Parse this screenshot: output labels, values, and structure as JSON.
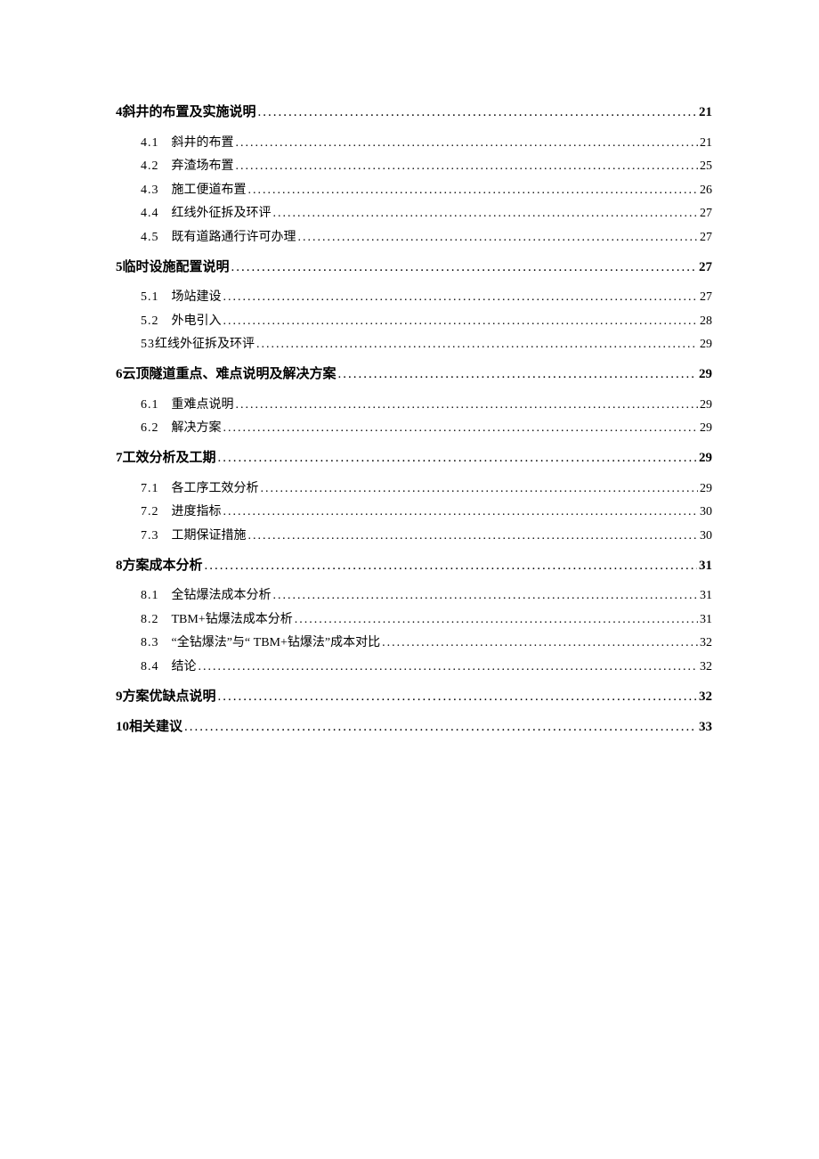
{
  "toc": [
    {
      "level": 1,
      "num": "4",
      "title": "斜井的布置及实施说明",
      "page": "21"
    },
    {
      "level": 2,
      "num": "4.1",
      "title": "斜井的布置",
      "page": "21"
    },
    {
      "level": 2,
      "num": "4.2",
      "title": "弃渣场布置",
      "page": "25"
    },
    {
      "level": 2,
      "num": "4.3",
      "title": "施工便道布置",
      "page": "26"
    },
    {
      "level": 2,
      "num": "4.4",
      "title": "红线外征拆及环评",
      "page": "27"
    },
    {
      "level": 2,
      "num": "4.5",
      "title": "既有道路通行许可办理",
      "page": "27"
    },
    {
      "level": 1,
      "num": "5",
      "title": "临时设施配置说明",
      "page": "27"
    },
    {
      "level": 2,
      "num": "5.1",
      "title": "场站建设",
      "page": "27"
    },
    {
      "level": 2,
      "num": "5.2",
      "title": "外电引入",
      "page": "28"
    },
    {
      "level": 2,
      "num": "53",
      "title": "红线外征拆及环评",
      "page": "29",
      "nogap": true
    },
    {
      "level": 1,
      "num": "6",
      "title": "云顶隧道重点、难点说明及解决方案",
      "page": "29"
    },
    {
      "level": 2,
      "num": "6.1",
      "title": "重难点说明",
      "page": "29"
    },
    {
      "level": 2,
      "num": "6.2",
      "title": "解决方案",
      "page": "29"
    },
    {
      "level": 1,
      "num": "7",
      "title": "工效分析及工期",
      "page": "29"
    },
    {
      "level": 2,
      "num": "7.1",
      "title": "各工序工效分析",
      "page": "29"
    },
    {
      "level": 2,
      "num": "7.2",
      "title": "进度指标",
      "page": "30"
    },
    {
      "level": 2,
      "num": "7.3",
      "title": "工期保证措施",
      "page": "30"
    },
    {
      "level": 1,
      "num": "8",
      "title": "方案成本分析",
      "page": "31"
    },
    {
      "level": 2,
      "num": "8.1",
      "title": "全钻爆法成本分析",
      "page": "31"
    },
    {
      "level": 2,
      "num": "8.2",
      "title": "TBM+钻爆法成本分析",
      "page": "31"
    },
    {
      "level": 2,
      "num": "8.3",
      "title": "“全钻爆法”与“ TBM+钻爆法”成本对比",
      "page": "32"
    },
    {
      "level": 2,
      "num": "8.4",
      "title": "结论",
      "page": "32"
    },
    {
      "level": 1,
      "num": "9",
      "title": "方案优缺点说明",
      "page": "32"
    },
    {
      "level": 1,
      "num": "10",
      "title": "相关建议",
      "page": "33"
    }
  ]
}
